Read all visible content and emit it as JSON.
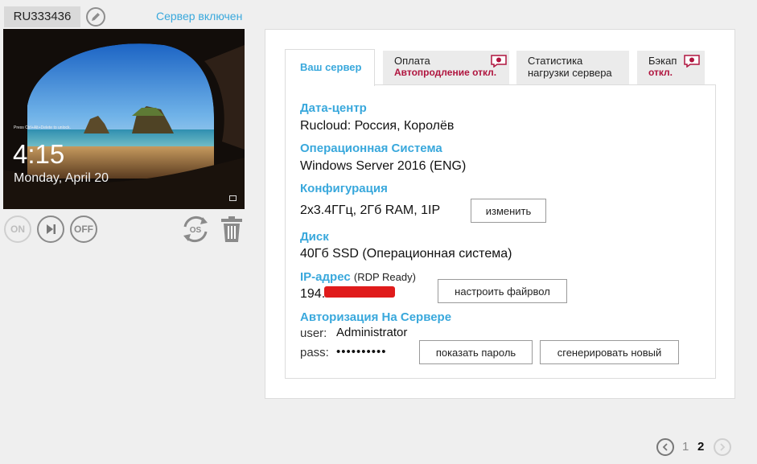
{
  "server": {
    "id": "RU333436",
    "status": "Сервер включен"
  },
  "lockscreen": {
    "hint": "Press Ctrl+Alt+Delete to unlock.",
    "time": "4:15",
    "date": "Monday, April 20"
  },
  "power": {
    "on_label": "ON",
    "off_label": "OFF"
  },
  "tabs": [
    {
      "title": "Ваш сервер",
      "sub": ""
    },
    {
      "title": "Оплата",
      "sub": "Автопродление откл."
    },
    {
      "title": "Статистика",
      "sub": "нагрузки сервера"
    },
    {
      "title": "Бэкап",
      "sub": "откл."
    }
  ],
  "details": {
    "datacenter_label": "Дата-центр",
    "datacenter_value": "Rucloud: Россия, Королёв",
    "os_label": "Операционная Система",
    "os_value": "Windows Server 2016 (ENG)",
    "config_label": "Конфигурация",
    "config_value": "2x3.4ГГц, 2Гб RAM, 1IP",
    "config_button": "изменить",
    "disk_label": "Диск",
    "disk_value": "40Гб SSD (Операционная система)",
    "ip_label": "IP-адрес",
    "ip_note": "(RDP Ready)",
    "ip_value": "194.",
    "firewall_button": "настроить файрвол",
    "auth_label": "Авторизация На Сервере",
    "user_key": "user:",
    "user_value": "Administrator",
    "pass_key": "pass:",
    "pass_value": "••••••••••",
    "show_password_button": "показать пароль",
    "generate_button": "сгенерировать новый"
  },
  "pagination": {
    "pages": [
      "1",
      "2"
    ],
    "current": "2"
  },
  "colors": {
    "accent": "#39a8dc",
    "warning": "#b0153f",
    "redaction": "#e01b1b"
  }
}
